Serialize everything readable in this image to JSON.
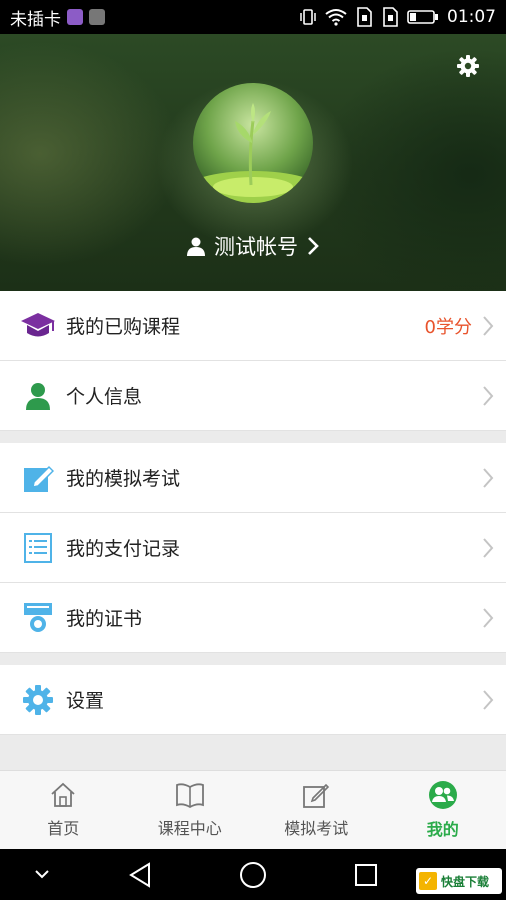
{
  "status_bar": {
    "carrier": "未插卡",
    "time": "01:07"
  },
  "profile": {
    "account_name": "测试帐号"
  },
  "menu": {
    "items": [
      {
        "label": "我的已购课程",
        "value": "0学分"
      },
      {
        "label": "个人信息",
        "value": ""
      },
      {
        "label": "我的模拟考试",
        "value": ""
      },
      {
        "label": "我的支付记录",
        "value": ""
      },
      {
        "label": "我的证书",
        "value": ""
      },
      {
        "label": "设置",
        "value": ""
      }
    ]
  },
  "tabs": [
    {
      "label": "首页",
      "active": false
    },
    {
      "label": "课程中心",
      "active": false
    },
    {
      "label": "模拟考试",
      "active": false
    },
    {
      "label": "我的",
      "active": true
    }
  ],
  "watermark": {
    "brand": "快盘下载"
  },
  "colors": {
    "accent_green": "#2bab4a",
    "value_red": "#e8532c",
    "course_purple": "#7b2fa0",
    "icon_blue": "#4fb3e8"
  }
}
